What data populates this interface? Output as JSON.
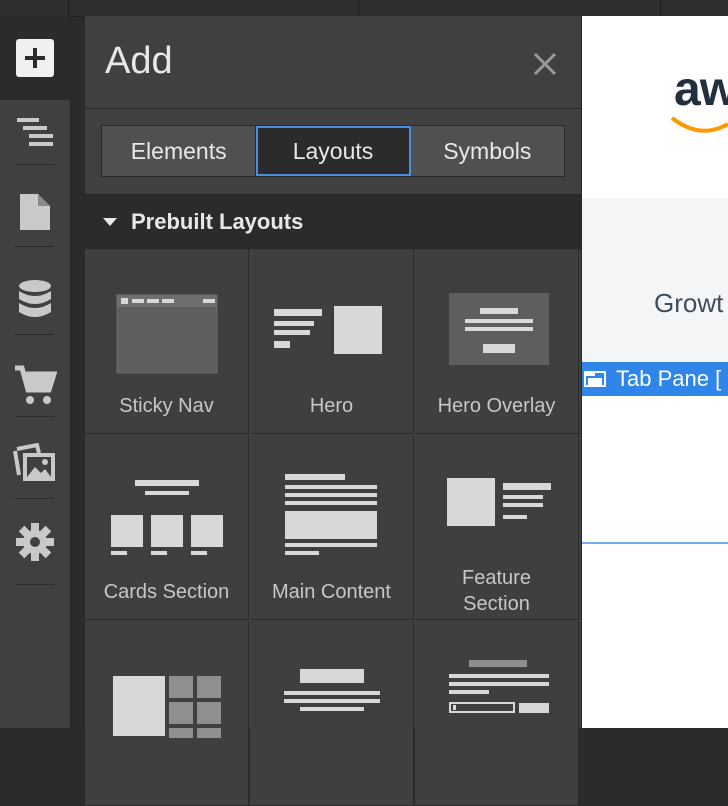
{
  "panel": {
    "title": "Add",
    "tabs": [
      {
        "label": "Elements",
        "selected": false
      },
      {
        "label": "Layouts",
        "selected": true
      },
      {
        "label": "Symbols",
        "selected": false
      }
    ],
    "section": "Prebuilt Layouts",
    "layouts": [
      "Sticky Nav",
      "Hero",
      "Hero Overlay",
      "Cards Section",
      "Main Content",
      "Feature\nSection"
    ]
  },
  "rail": {
    "items": [
      "add-icon",
      "navigator-icon",
      "pages-icon",
      "cms-icon",
      "ecommerce-icon",
      "assets-icon",
      "settings-icon"
    ]
  },
  "canvas": {
    "logo_text": "aw",
    "heading_text": "Growt",
    "selected_element": "Tab Pane [",
    "accent": "#2f86e8",
    "logo_color": "#232f3e",
    "logo_smile_color": "#ff9900"
  },
  "colors": {
    "tab_focus": "#4a8fe0",
    "panel_bg": "#404040"
  }
}
